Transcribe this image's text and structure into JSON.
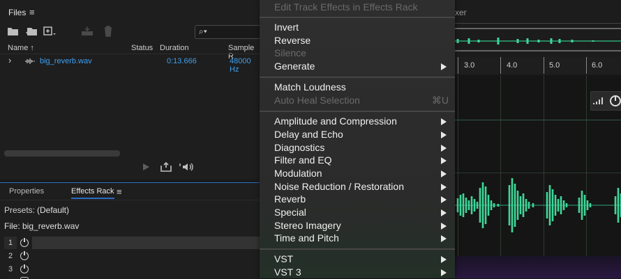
{
  "files_panel": {
    "title": "Files",
    "menu_glyph": "≡",
    "search_glyph": "⌕▾",
    "columns": [
      "Name ↑",
      "Status",
      "Duration",
      "Sample R"
    ],
    "file": {
      "expand_glyph": "›",
      "name": "big_reverb.wav",
      "duration": "0:13.666",
      "sample_rate": "48000 Hz"
    }
  },
  "effects_panel": {
    "tabs": [
      "Properties",
      "Effects Rack"
    ],
    "menu_glyph": "≡",
    "presets_label": "Presets:",
    "presets_value": "(Default)",
    "file_label": "File: big_reverb.wav",
    "slots": [
      "1",
      "2",
      "3"
    ]
  },
  "wave_area": {
    "tab_fragment": "xer",
    "ruler": [
      "3.0",
      "4.0",
      "5.0",
      "6.0"
    ]
  },
  "context_menu": {
    "top_item": "Edit Track Effects in Effects Rack",
    "group1": [
      {
        "label": "Invert",
        "disabled": false,
        "arrow": false
      },
      {
        "label": "Reverse",
        "disabled": false,
        "arrow": false
      },
      {
        "label": "Silence",
        "disabled": true,
        "arrow": false
      },
      {
        "label": "Generate",
        "disabled": false,
        "arrow": true
      }
    ],
    "group2": [
      {
        "label": "Match Loudness",
        "disabled": false
      },
      {
        "label": "Auto Heal Selection",
        "disabled": true,
        "shortcut": "⌘U"
      }
    ],
    "group3": [
      "Amplitude and Compression",
      "Delay and Echo",
      "Diagnostics",
      "Filter and EQ",
      "Modulation",
      "Noise Reduction / Restoration",
      "Reverb",
      "Special",
      "Stereo Imagery",
      "Time and Pitch"
    ],
    "group4": [
      "VST",
      "VST 3"
    ]
  },
  "colors": {
    "accent": "#2b6cc4",
    "file_link": "#3ea0f0",
    "waveform": "#3fd79a"
  }
}
